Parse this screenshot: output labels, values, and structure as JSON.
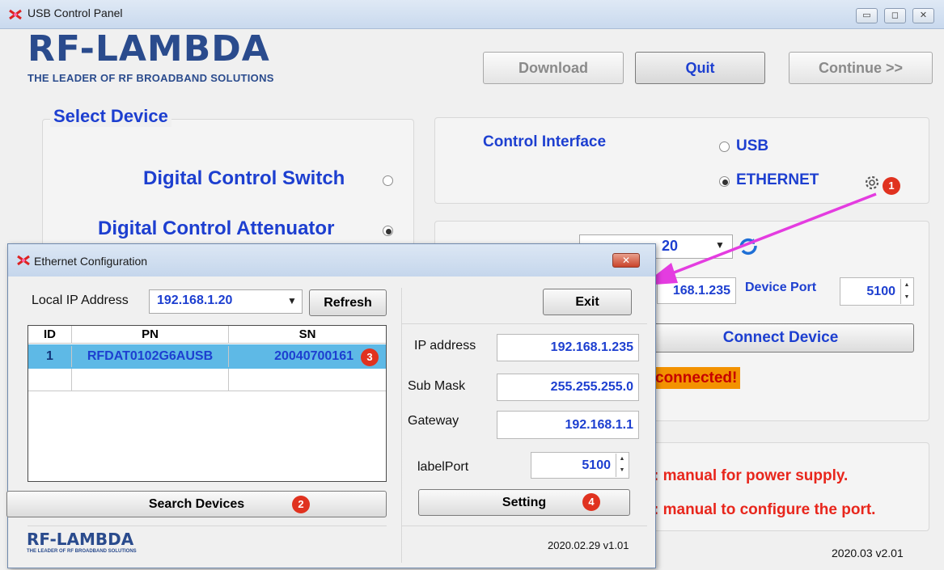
{
  "window": {
    "title": "USB Control Panel",
    "minimize_glyph": "▭",
    "maximize_glyph": "◻",
    "close_glyph": "✕"
  },
  "logo": {
    "name": "RF-LAMBDA",
    "tagline": "THE LEADER OF RF BROADBAND SOLUTIONS"
  },
  "toolbar": {
    "download_label": "Download",
    "quit_label": "Quit",
    "continue_label": "Continue >>"
  },
  "select_device": {
    "title": "Select Device",
    "options": [
      {
        "label": "Digital Control Switch",
        "selected": false
      },
      {
        "label": "Digital Control Attenuator",
        "selected": true
      }
    ]
  },
  "control_interface": {
    "title": "Control Interface",
    "options": [
      {
        "label": "USB",
        "selected": false
      },
      {
        "label": "ETHERNET",
        "selected": true
      }
    ],
    "settings_icon": "gear-icon"
  },
  "connection": {
    "local_ip_partial": "20",
    "device_ip_partial": "168.1.235",
    "device_port_label": "Device Port",
    "device_port_value": "5100",
    "connect_label": "Connect Device",
    "status_partial": "connected!",
    "refresh_icon": "refresh-icon"
  },
  "notes": {
    "line1": ": manual for power supply.",
    "line2": ": manual to configure the port."
  },
  "main_version": "2020.03 v2.01",
  "badges": [
    "1",
    "2",
    "3",
    "4"
  ],
  "dialog": {
    "title": "Ethernet Configuration",
    "local_ip_label": "Local IP Address",
    "local_ip_value": "192.168.1.20",
    "refresh_label": "Refresh",
    "exit_label": "Exit",
    "table": {
      "columns": [
        "ID",
        "PN",
        "SN"
      ],
      "rows": [
        {
          "id": "1",
          "pn": "RFDAT0102G6AUSB",
          "sn": "20040700161"
        }
      ]
    },
    "fields": {
      "ip_label": "IP address",
      "ip_value": "192.168.1.235",
      "mask_label": "Sub Mask",
      "mask_value": "255.255.255.0",
      "gateway_label": "Gateway",
      "gateway_value": "192.168.1.1",
      "port_label": "labelPort",
      "port_value": "5100"
    },
    "search_label": "Search Devices",
    "setting_label": "Setting",
    "logo_name": "RF-LAMBDA",
    "logo_tagline": "THE LEADER OF RF BROADBAND SOLUTIONS",
    "version": "2020.02.29 v1.01"
  },
  "colors": {
    "accent_blue": "#1d3fd0",
    "logo_blue": "#2a4b8d",
    "badge_red": "#e0321f",
    "status_orange": "#f39200",
    "selection_blue": "#5eb9e6",
    "pointer_magenta": "#e43ce0"
  }
}
